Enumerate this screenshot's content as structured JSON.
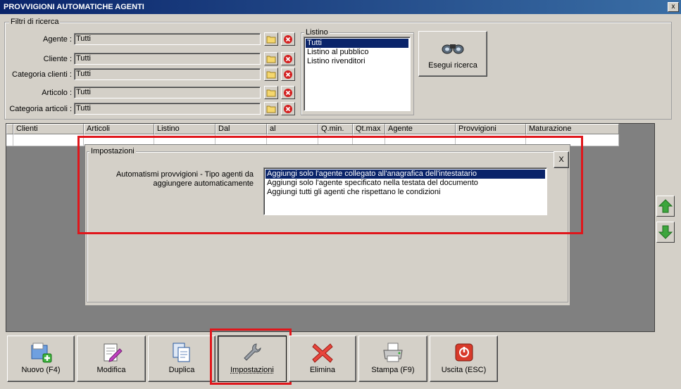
{
  "window": {
    "title": "PROVVIGIONI AUTOMATICHE AGENTI",
    "close_label": "x"
  },
  "filters": {
    "group_label": "Filtri di ricerca",
    "fields": [
      {
        "label": "Agente :",
        "value": "Tutti"
      },
      {
        "label": "Cliente :",
        "value": "Tutti"
      },
      {
        "label": "Categoria clienti :",
        "value": "Tutti"
      },
      {
        "label": "Articolo :",
        "value": "Tutti"
      },
      {
        "label": "Categoria articoli :",
        "value": "Tutti"
      }
    ],
    "listino": {
      "label": "Listino",
      "items": [
        "Tutti",
        "Listino al pubblico",
        "Listino rivenditori"
      ],
      "selected_index": 0
    },
    "search_button_label": "Esegui ricerca"
  },
  "grid": {
    "columns": [
      "Clienti",
      "Articoli",
      "Listino",
      "Dal",
      "al",
      "Q.min.",
      "Qt.max",
      "Agente",
      "Provvigioni",
      "Maturazione"
    ]
  },
  "settings_panel": {
    "title": "Impostazioni",
    "close_label": "X",
    "field_label": "Automatismi provvigioni - Tipo agenti da aggiungere automaticamente",
    "options": [
      "Aggiungi solo l'agente collegato all'anagrafica dell'intestatario",
      "Aggiungi solo l'agente specificato nella testata del documento",
      "Aggiungi tutti gli agenti che rispettano le condizioni"
    ],
    "selected_index": 0
  },
  "toolbar": {
    "buttons": [
      {
        "label": "Nuovo (F4)",
        "icon": "new-icon"
      },
      {
        "label": "Modifica",
        "icon": "edit-icon"
      },
      {
        "label": "Duplica",
        "icon": "duplicate-icon"
      },
      {
        "label": "Impostazioni",
        "icon": "wrench-icon"
      },
      {
        "label": "Elimina",
        "icon": "delete-x-icon"
      },
      {
        "label": "Stampa (F9)",
        "icon": "printer-icon"
      },
      {
        "label": "Uscita (ESC)",
        "icon": "power-icon"
      }
    ]
  },
  "colors": {
    "title_gradient_start": "#0a246a",
    "title_gradient_end": "#3a6ea5",
    "highlight_red": "#e0161b",
    "selection_blue": "#0a246a",
    "arrow_green": "#3da63d"
  }
}
